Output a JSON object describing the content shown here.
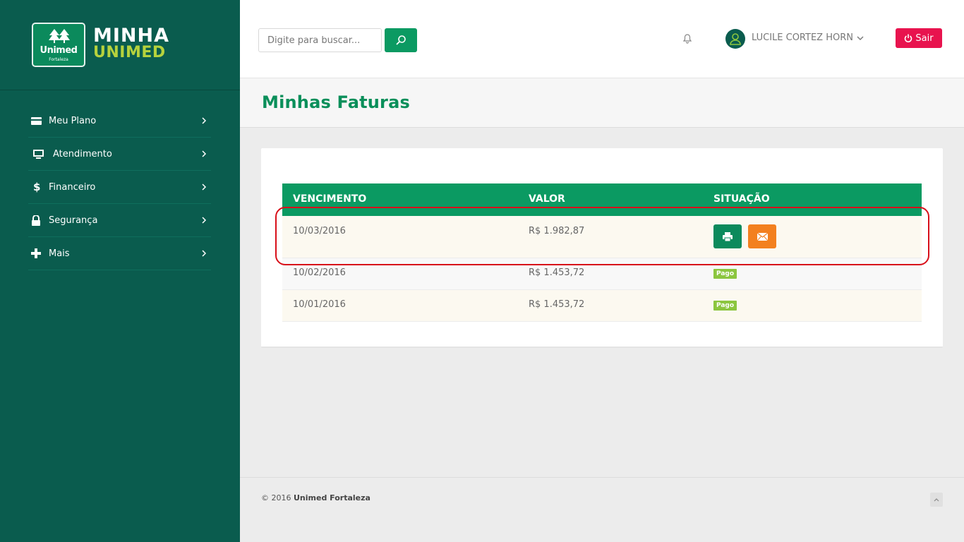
{
  "brand": {
    "badge_name": "Unimed",
    "badge_city": "Fortaleza",
    "title_line1": "MINHA",
    "title_line2": "UNIMED"
  },
  "sidebar": {
    "items": [
      {
        "label": "Meu Plano",
        "icon": "card-icon"
      },
      {
        "label": "Atendimento",
        "icon": "monitor-icon"
      },
      {
        "label": "Financeiro",
        "icon": "dollar-icon"
      },
      {
        "label": "Segurança",
        "icon": "lock-icon"
      },
      {
        "label": "Mais",
        "icon": "plus-icon"
      }
    ]
  },
  "header": {
    "search_placeholder": "Digite para buscar...",
    "user_name": "LUCILE CORTEZ HORN",
    "logout_label": "Sair"
  },
  "page": {
    "title": "Minhas Faturas"
  },
  "table": {
    "columns": [
      "VENCIMENTO",
      "VALOR",
      "SITUAÇÃO"
    ],
    "rows": [
      {
        "vencimento": "10/03/2016",
        "valor": "R$ 1.982,87",
        "situacao": ""
      },
      {
        "vencimento": "10/02/2016",
        "valor": "R$ 1.453,72",
        "situacao": "Pago"
      },
      {
        "vencimento": "10/01/2016",
        "valor": "R$ 1.453,72",
        "situacao": "Pago"
      }
    ]
  },
  "footer": {
    "copyright_prefix": "© 2016 ",
    "copyright_name": "Unimed Fortaleza"
  },
  "colors": {
    "sidebar": "#0a5c4e",
    "primary": "#0b9a62",
    "accent_lime": "#b6d23d",
    "logout": "#e8134e",
    "email": "#f3801f",
    "paid_badge": "#8cc63f",
    "highlight": "#d8101a"
  }
}
